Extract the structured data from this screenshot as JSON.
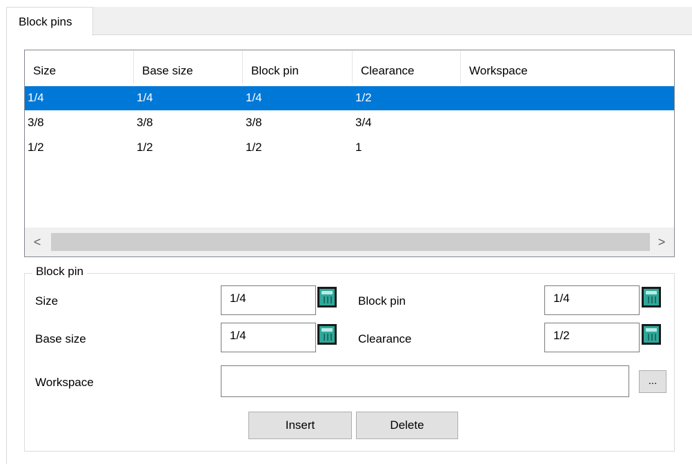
{
  "tabs": [
    {
      "label": "Block pins"
    }
  ],
  "list": {
    "columns": [
      "Size",
      "Base size",
      "Block pin",
      "Clearance",
      "Workspace"
    ],
    "rows": [
      {
        "size": "1/4",
        "base_size": "1/4",
        "block_pin": "1/4",
        "clearance": "1/2",
        "workspace": ""
      },
      {
        "size": "3/8",
        "base_size": "3/8",
        "block_pin": "3/8",
        "clearance": "3/4",
        "workspace": ""
      },
      {
        "size": "1/2",
        "base_size": "1/2",
        "block_pin": "1/2",
        "clearance": "1",
        "workspace": ""
      }
    ],
    "selected_row": 0,
    "scroll_left_glyph": "<",
    "scroll_right_glyph": ">"
  },
  "group": {
    "title": "Block pin",
    "size_label": "Size",
    "size_value": "1/4",
    "base_size_label": "Base size",
    "base_size_value": "1/4",
    "block_pin_label": "Block pin",
    "block_pin_value": "1/4",
    "clearance_label": "Clearance",
    "clearance_value": "1/2",
    "workspace_label": "Workspace",
    "workspace_value": "",
    "browse_label": "...",
    "calculator_icon": "calculator-icon"
  },
  "buttons": {
    "insert": "Insert",
    "delete": "Delete"
  },
  "colors": {
    "selection": "#0078d7",
    "calculator": "#2fa89a"
  }
}
